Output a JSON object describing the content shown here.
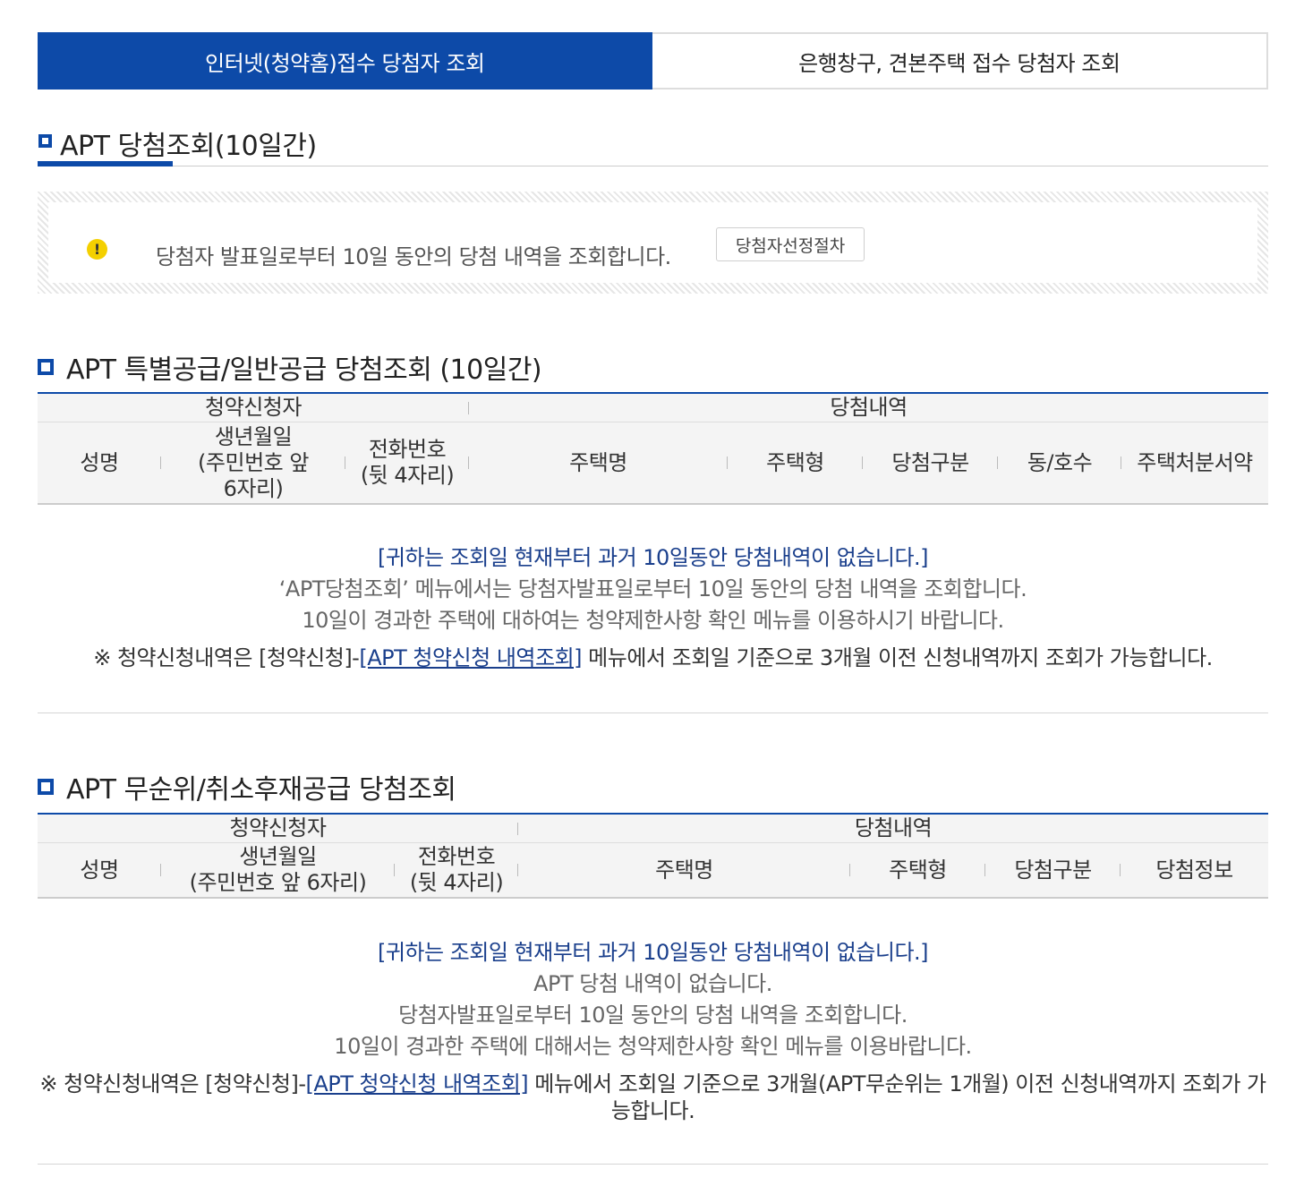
{
  "tabs": [
    {
      "label": "인터넷(청약홈)접수 당첨자 조회",
      "active": true
    },
    {
      "label": "은행창구, 견본주택 접수 당첨자 조회",
      "active": false
    }
  ],
  "page_title": "APT 당첨조회(10일간)",
  "notice": {
    "text": "당첨자 발표일로부터 10일 동안의 당첨 내역을 조회합니다.",
    "button": "당첨자선정절차"
  },
  "section1": {
    "title": "APT 특별공급/일반공급 당첨조회 (10일간)",
    "group_applicant": "청약신청자",
    "group_result": "당첨내역",
    "cols": {
      "name": "성명",
      "birth_l1": "생년월일",
      "birth_l2": "(주민번호 앞",
      "birth_l3": "6자리)",
      "phone_l1": "전화번호",
      "phone_l2": "(뒷 4자리)",
      "house": "주택명",
      "type": "주택형",
      "win_type": "당첨구분",
      "unit": "동/호수",
      "disposal": "주택처분서약"
    },
    "empty_title": "[귀하는 조회일 현재부터 과거 10일동안 당첨내역이 없습니다.]",
    "empty_lines": [
      "‘APT당첨조회’ 메뉴에서는 당첨자발표일로부터 10일 동안의 당첨 내역을 조회합니다.",
      "10일이 경과한 주택에 대하여는 청약제한사항 확인 메뉴를 이용하시기 바랍니다."
    ],
    "note_prefix": "※ 청약신청내역은 [청약신청]-",
    "note_link": "[APT 청약신청 내역조회]",
    "note_suffix": " 메뉴에서 조회일 기준으로 3개월 이전 신청내역까지 조회가 가능합니다."
  },
  "section2": {
    "title": "APT 무순위/취소후재공급 당첨조회",
    "group_applicant": "청약신청자",
    "group_result": "당첨내역",
    "cols": {
      "name": "성명",
      "birth_l1": "생년월일",
      "birth_l2": "(주민번호 앞 6자리)",
      "phone_l1": "전화번호",
      "phone_l2": "(뒷 4자리)",
      "house": "주택명",
      "type": "주택형",
      "win_type": "당첨구분",
      "win_info": "당첨정보"
    },
    "empty_title": "[귀하는 조회일 현재부터 과거 10일동안 당첨내역이 없습니다.]",
    "empty_lines": [
      "APT 당첨 내역이 없습니다.",
      "당첨자발표일로부터 10일 동안의 당첨 내역을 조회합니다.",
      "10일이 경과한 주택에 대해서는 청약제한사항 확인 메뉴를 이용바랍니다."
    ],
    "note_prefix": "※ 청약신청내역은 [청약신청]-",
    "note_link": "[APT 청약신청 내역조회]",
    "note_suffix": " 메뉴에서 조회일 기준으로 3개월(APT무순위는 1개월) 이전 신청내역까지 조회가 가능합니다."
  }
}
